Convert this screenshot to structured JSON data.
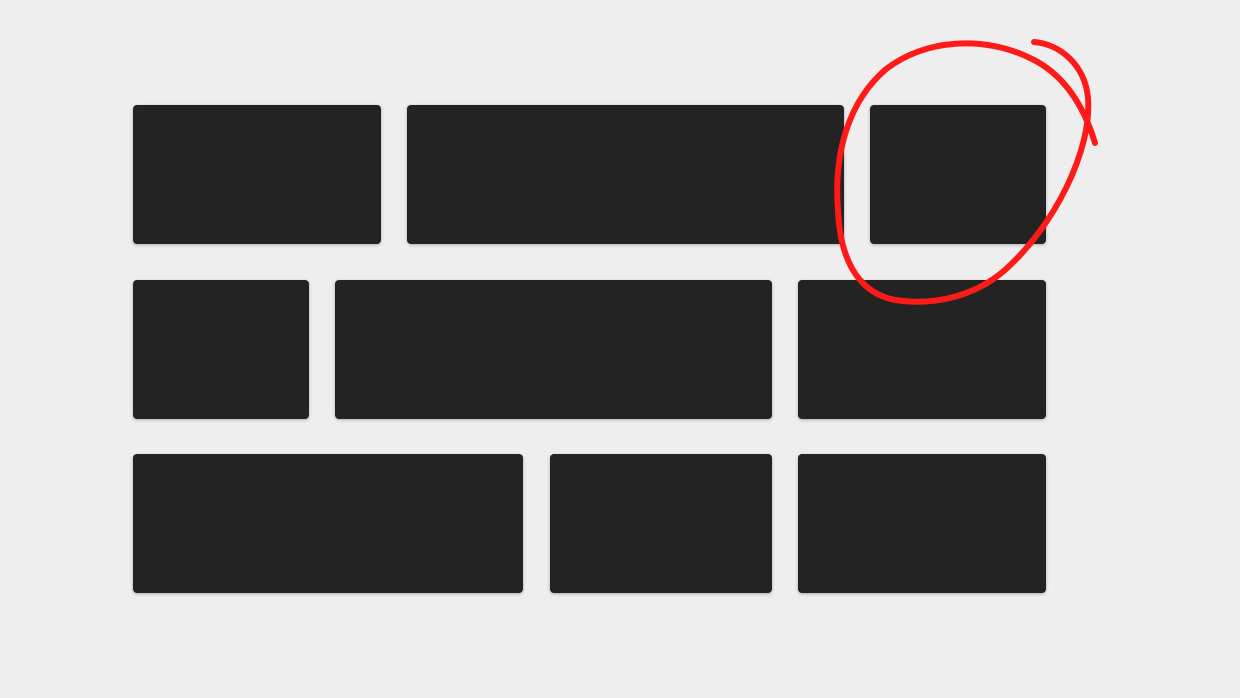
{
  "colors": {
    "background": "#efeeee",
    "tile": "#232323",
    "annotation": "#ff1a1a"
  },
  "grid": {
    "rows": 3,
    "tiles_per_row": [
      3,
      3,
      3
    ],
    "highlighted_tile": "row-1 tile-3"
  },
  "annotation": {
    "shape": "freehand-circle",
    "target": "tile-r1-c3"
  }
}
